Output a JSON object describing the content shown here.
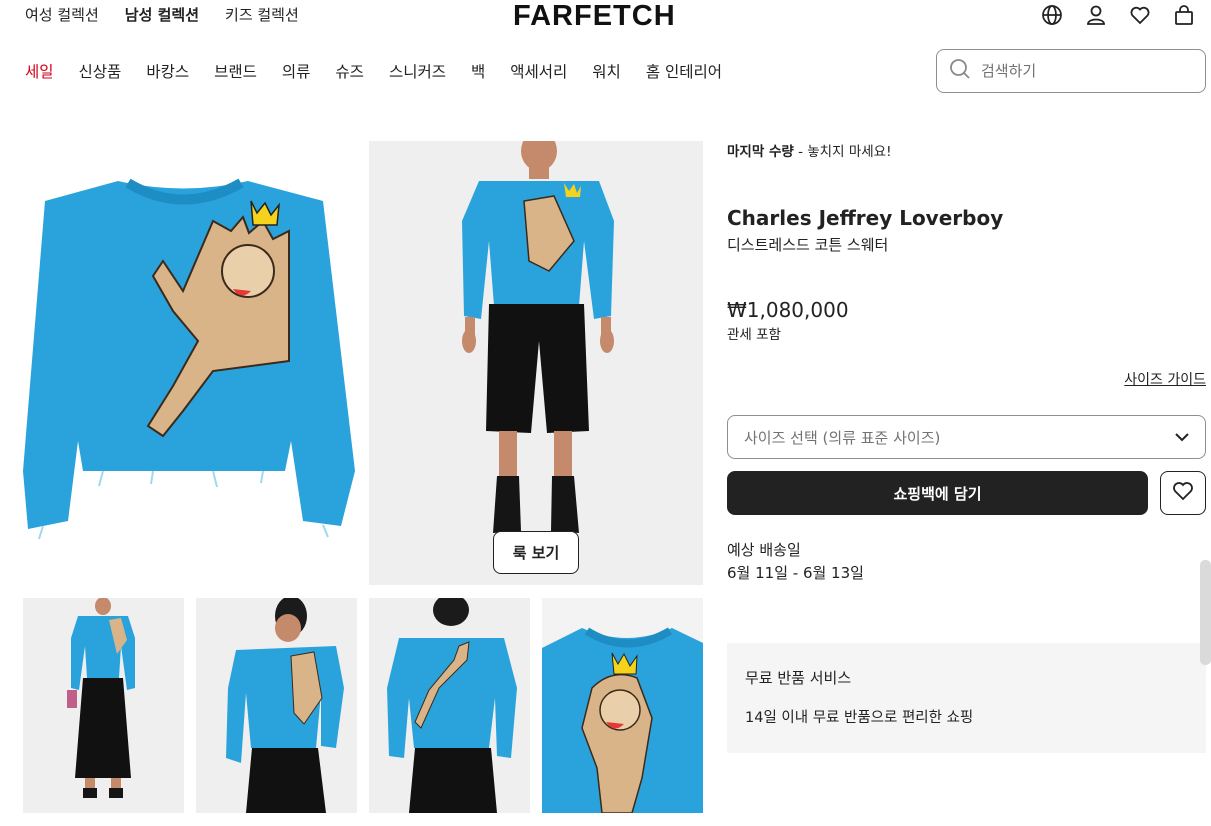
{
  "header": {
    "gender_tabs": [
      {
        "label": "여성 컬렉션",
        "active": false
      },
      {
        "label": "남성 컬렉션",
        "active": true
      },
      {
        "label": "키즈 컬렉션",
        "active": false
      }
    ],
    "logo": "FARFETCH",
    "icons": [
      "globe-icon",
      "account-icon",
      "wishlist-icon",
      "shopping-bag-icon"
    ]
  },
  "categories": [
    "세일",
    "신상품",
    "바캉스",
    "브랜드",
    "의류",
    "슈즈",
    "스니커즈",
    "백",
    "액세서리",
    "워치",
    "홈 인테리어"
  ],
  "search": {
    "placeholder": "검색하기"
  },
  "gallery": {
    "look_button": "룩 보기"
  },
  "product": {
    "urgency_bold": "마지막 수량",
    "urgency_rest": " - 놓치지 마세요!",
    "brand": "Charles Jeffrey Loverboy",
    "name": "디스트레스드 코튼 스웨터",
    "price": "₩1,080,000",
    "tax_note": "관세 포함",
    "size_guide": "사이즈 가이드",
    "size_select": "사이즈 선택 (의류 표준 사이즈)",
    "add_to_bag": "쇼핑백에 담기",
    "delivery_label": "예상 배송일",
    "delivery_date": "6월 11일 - 6월 13일"
  },
  "returns": {
    "title": "무료 반품 서비스",
    "description": "14일 이내 무료 반품으로 편리한 쇼핑"
  },
  "colors": {
    "sweater": "#2aa3dc",
    "sale": "#d0021b",
    "button_dark": "#222222"
  }
}
